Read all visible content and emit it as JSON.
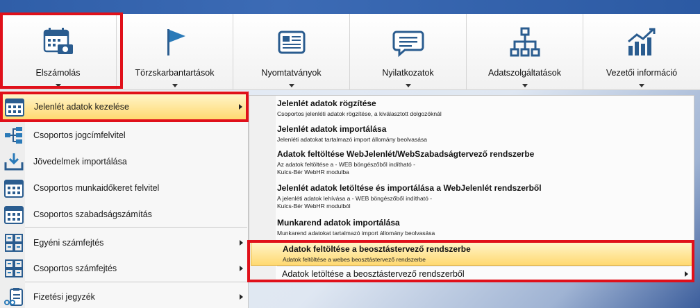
{
  "ribbon": {
    "items": [
      {
        "label": "Elszámolás",
        "icon": "calendar-money-icon"
      },
      {
        "label": "Törzskarbantartások",
        "icon": "flag-icon"
      },
      {
        "label": "Nyomtatványok",
        "icon": "document-form-icon"
      },
      {
        "label": "Nyilatkozatok",
        "icon": "speech-bubble-icon"
      },
      {
        "label": "Adatszolgáltatások",
        "icon": "org-chart-icon"
      },
      {
        "label": "Vezetői információ",
        "icon": "bar-chart-growth-icon"
      }
    ]
  },
  "left_menu": {
    "items": [
      {
        "label": "Jelenlét adatok kezelése",
        "icon": "calendar-icon",
        "has_submenu": true
      },
      {
        "label": "Csoportos jogcímfelvitel",
        "icon": "hierarchy-icon",
        "has_submenu": false
      },
      {
        "label": "Jövedelmek importálása",
        "icon": "download-tray-icon",
        "has_submenu": false
      },
      {
        "label": "Csoportos munkaidőkeret felvitel",
        "icon": "calendar-icon",
        "has_submenu": false
      },
      {
        "label": "Csoportos szabadságszámítás",
        "icon": "calendar-icon",
        "has_submenu": false
      },
      {
        "label": "Egyéni számfejtés",
        "icon": "grid-icon",
        "has_submenu": true
      },
      {
        "label": "Csoportos számfejtés",
        "icon": "grid-icon",
        "has_submenu": true
      },
      {
        "label": "Fizetési jegyzék",
        "icon": "clipboard-glasses-icon",
        "has_submenu": true
      }
    ]
  },
  "submenu": {
    "items": [
      {
        "title": "Jelenlét adatok rögzítése",
        "desc": "Csoportos jelenléti adatok rögzítése, a kiválasztott dolgozóknál"
      },
      {
        "title": "Jelenlét adatok importálása",
        "desc": "Jelenléti adatokat tartalmazó import állomány beolvasása"
      },
      {
        "title": "Adatok feltöltése WebJelenlét/WebSzabadságtervező rendszerbe",
        "desc": "Az adatok feltöltése a - WEB böngészőből indítható -",
        "desc2": "Kulcs-Bér WebHR modulba"
      },
      {
        "title": "Jelenlét adatok letöltése és importálása a WebJelenlét rendszerből",
        "desc": "A jelenléti adatok lehívása a - WEB böngészőből indítható -",
        "desc2": "Kulcs-Bér WebHR modulból"
      },
      {
        "title": "Munkarend adatok importálása",
        "desc": "Munkarend adatokat tartalmazó import állomány beolvasása"
      },
      {
        "title": "Adatok feltöltése a beosztástervező rendszerbe",
        "desc": "Adatok feltöltése a webes beosztástervező rendszerbe"
      }
    ],
    "plain_item": {
      "label": "Adatok letöltése a beosztástervező rendszerből"
    }
  },
  "colors": {
    "highlight_border": "#e0101a",
    "active_bg": "#ffd971",
    "accent_blue": "#2f5ea8"
  }
}
